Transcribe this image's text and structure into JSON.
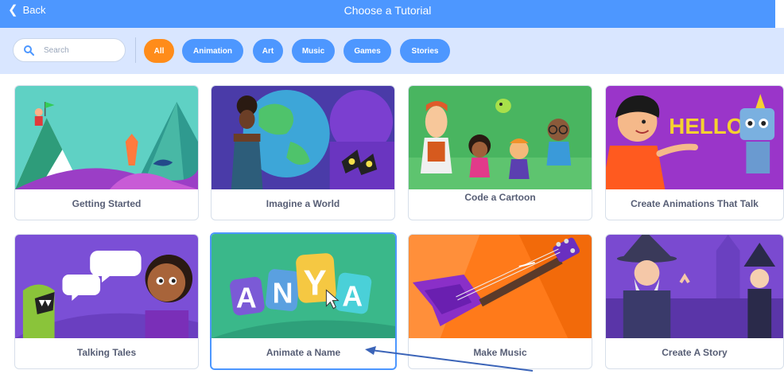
{
  "header": {
    "back_label": "Back",
    "title": "Choose a Tutorial"
  },
  "search": {
    "placeholder": "Search"
  },
  "filters": [
    {
      "label": "All",
      "active": true
    },
    {
      "label": "Animation",
      "active": false
    },
    {
      "label": "Art",
      "active": false
    },
    {
      "label": "Music",
      "active": false
    },
    {
      "label": "Games",
      "active": false
    },
    {
      "label": "Stories",
      "active": false
    }
  ],
  "tutorials": [
    {
      "title": "Getting Started"
    },
    {
      "title": "Imagine a World"
    },
    {
      "title": "Code a Cartoon"
    },
    {
      "title": "Create Animations That Talk"
    },
    {
      "title": "Talking Tales"
    },
    {
      "title": "Animate a Name",
      "letters": [
        "A",
        "N",
        "Y",
        "A"
      ]
    },
    {
      "title": "Make Music"
    },
    {
      "title": "Create A Story"
    }
  ],
  "art_texts": {
    "hello": "HELLO"
  },
  "colors": {
    "primary": "#4d97ff",
    "active_filter": "#ff8c1a",
    "label_text": "#575e75"
  }
}
